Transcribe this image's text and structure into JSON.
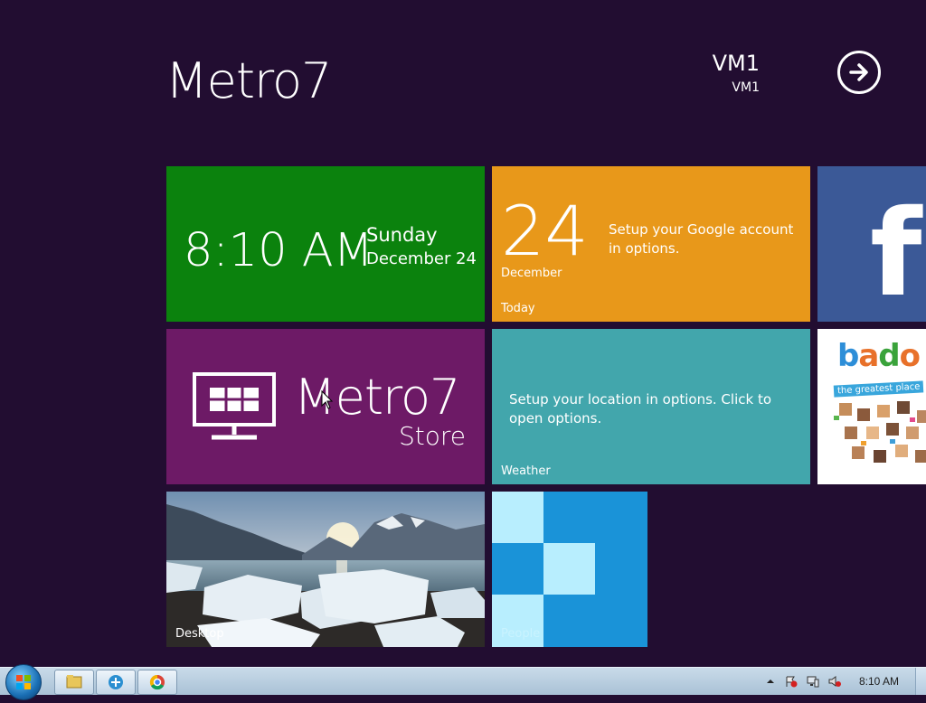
{
  "header": {
    "app_title": "Metro7",
    "user_name": "VM1",
    "user_sub": "VM1",
    "signout_icon": "arrow-right-circle-icon"
  },
  "tiles": {
    "clock": {
      "time": "8:10 AM",
      "day": "Sunday",
      "date": "December 24",
      "color": "#0b820d"
    },
    "calendar": {
      "day": "24",
      "month": "December",
      "label": "Today",
      "message": "Setup your Google account in options.",
      "color": "#e8981a"
    },
    "facebook": {
      "letter": "f",
      "color": "#3b5997"
    },
    "store": {
      "name": "Metro7",
      "sub": "Store",
      "color": "#6d1a66"
    },
    "weather": {
      "message": "Setup your location in options. Click to open options.",
      "label": "Weather",
      "color": "#42a6ac"
    },
    "badoo": {
      "logo": "bado",
      "tag": "the greatest place"
    },
    "desktop": {
      "label": "Desktop"
    },
    "people": {
      "label": "People",
      "color": "#1a93d8"
    }
  },
  "taskbar": {
    "clock": "8:10 AM",
    "pinned": [
      "explorer-icon",
      "metro7-icon",
      "chrome-icon"
    ],
    "tray_icons": [
      "show-hidden-icons-icon",
      "action-center-icon",
      "network-icon",
      "volume-muted-icon"
    ]
  }
}
